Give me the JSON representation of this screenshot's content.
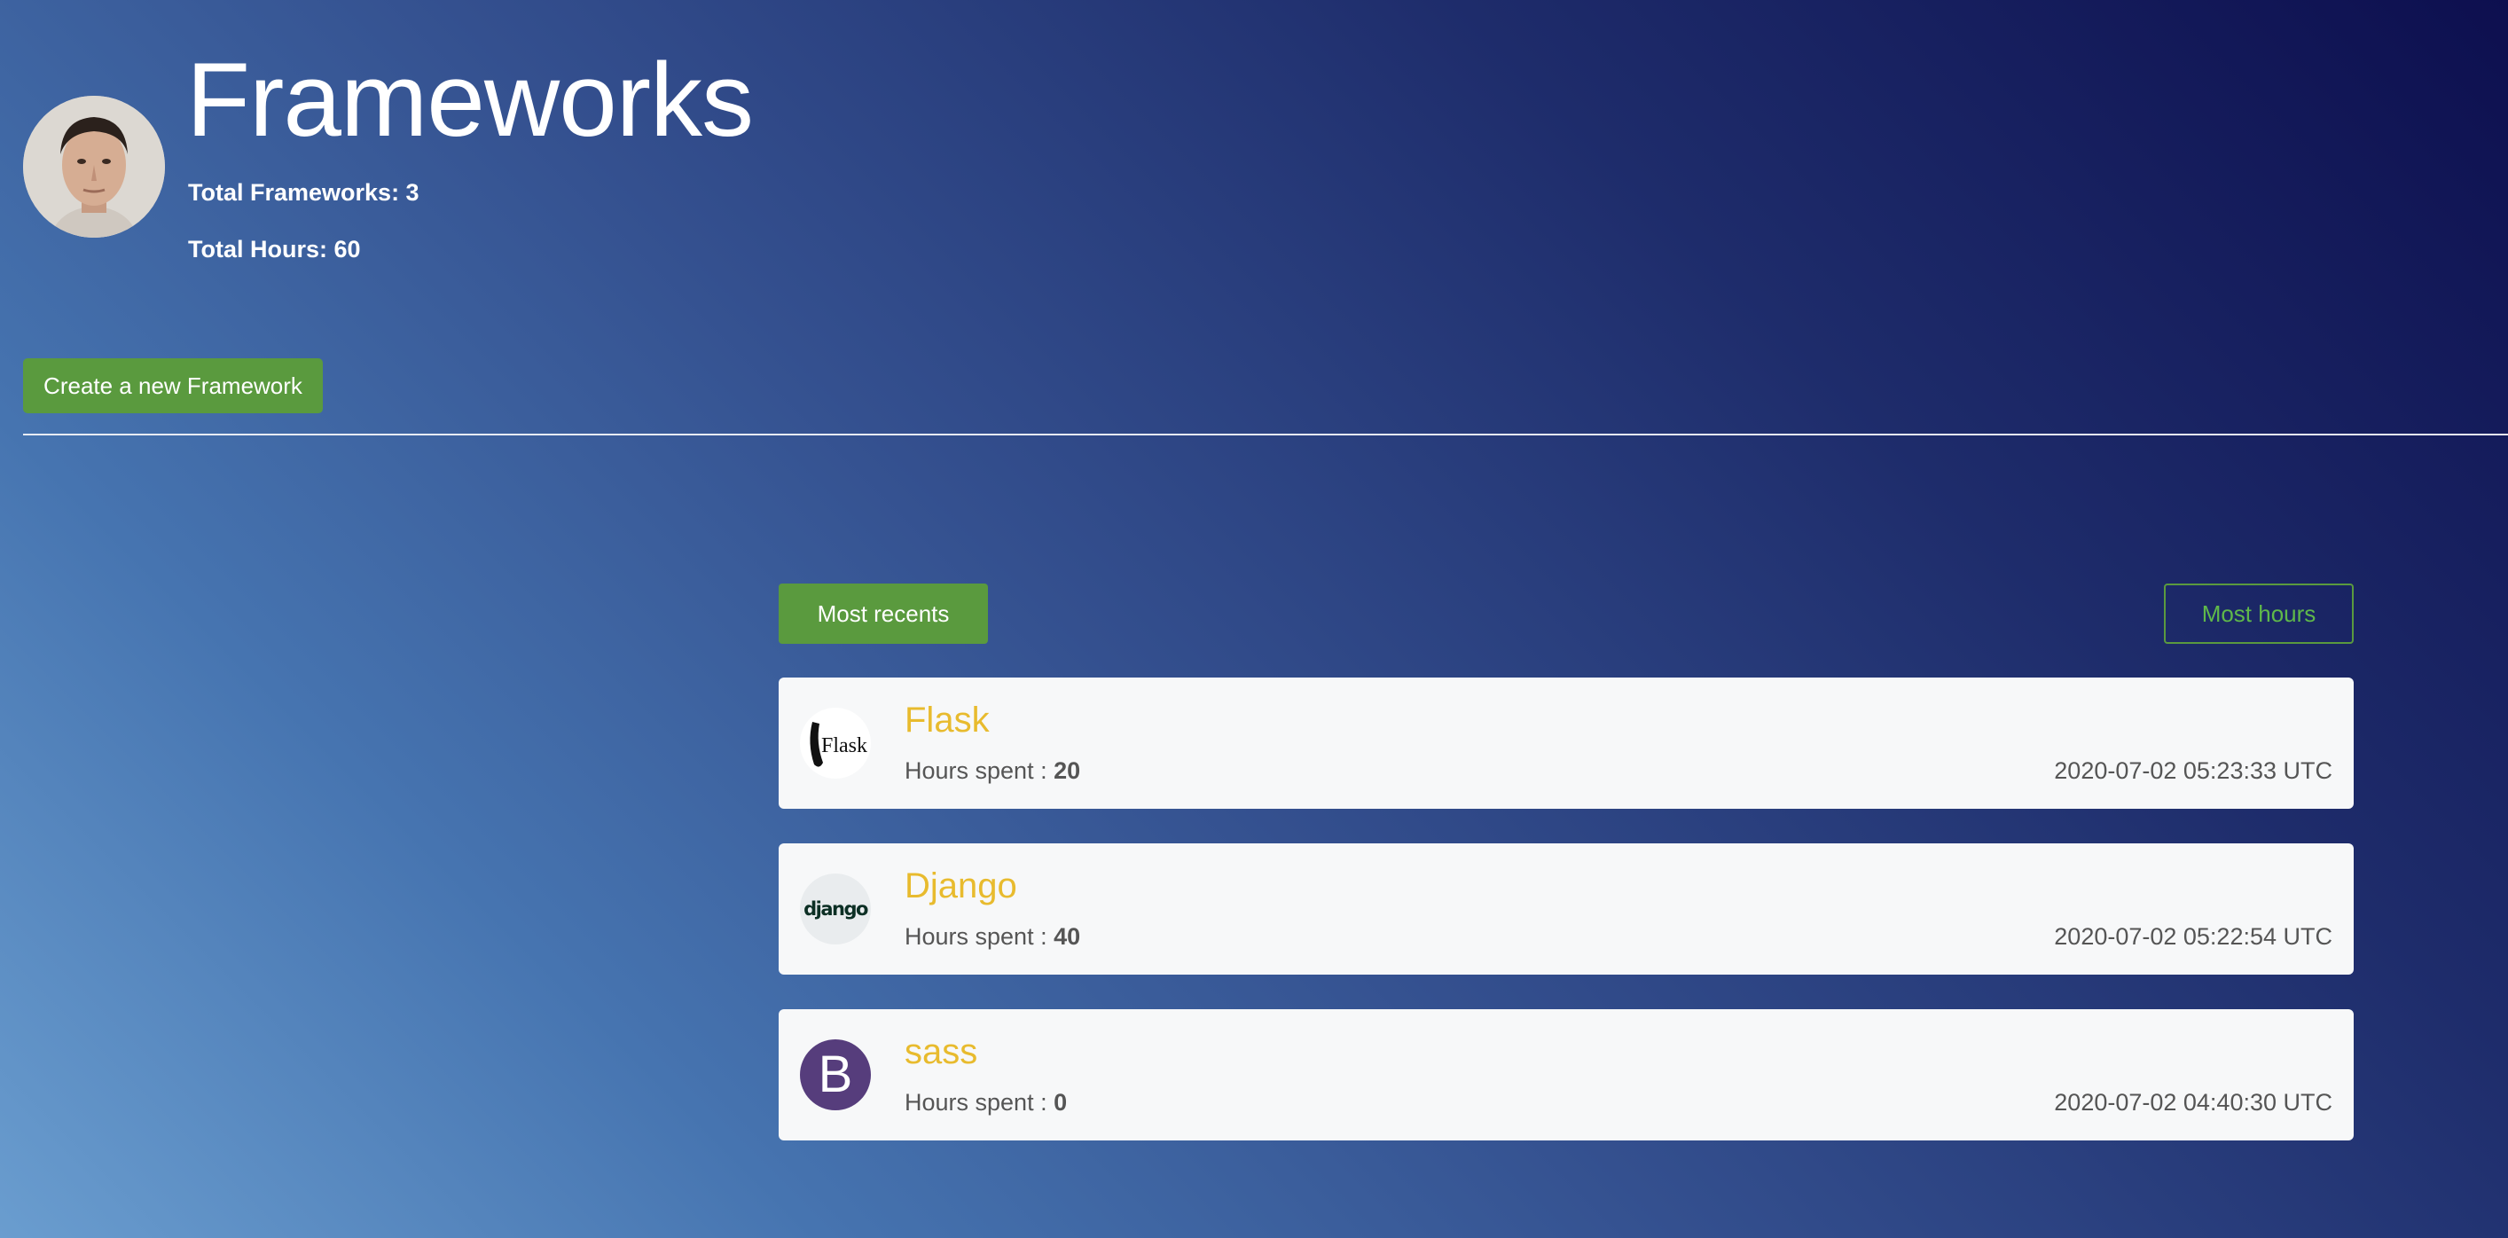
{
  "header": {
    "title": "Frameworks",
    "total_frameworks": "Total Frameworks: 3",
    "total_hours": "Total Hours: 60"
  },
  "actions": {
    "create_label": "Create a new Framework"
  },
  "sort": {
    "recent_label": "Most recents",
    "hours_label": "Most hours"
  },
  "frameworks": [
    {
      "name": "Flask",
      "hours_label": "Hours spent :",
      "hours": "20",
      "date": "2020-07-02 05:23:33 UTC",
      "logo_text": "Flask",
      "icon": "flask-logo-icon"
    },
    {
      "name": "Django",
      "hours_label": "Hours spent :",
      "hours": "40",
      "date": "2020-07-02 05:22:54 UTC",
      "logo_text": "django",
      "icon": "django-logo-icon"
    },
    {
      "name": "sass",
      "hours_label": "Hours spent :",
      "hours": "0",
      "date": "2020-07-02 04:40:30 UTC",
      "logo_text": "B",
      "icon": "bootstrap-logo-icon"
    }
  ],
  "colors": {
    "accent_green": "#5a9a3e",
    "title_yellow": "#e8bb2e",
    "bootstrap_purple": "#563d7c"
  }
}
